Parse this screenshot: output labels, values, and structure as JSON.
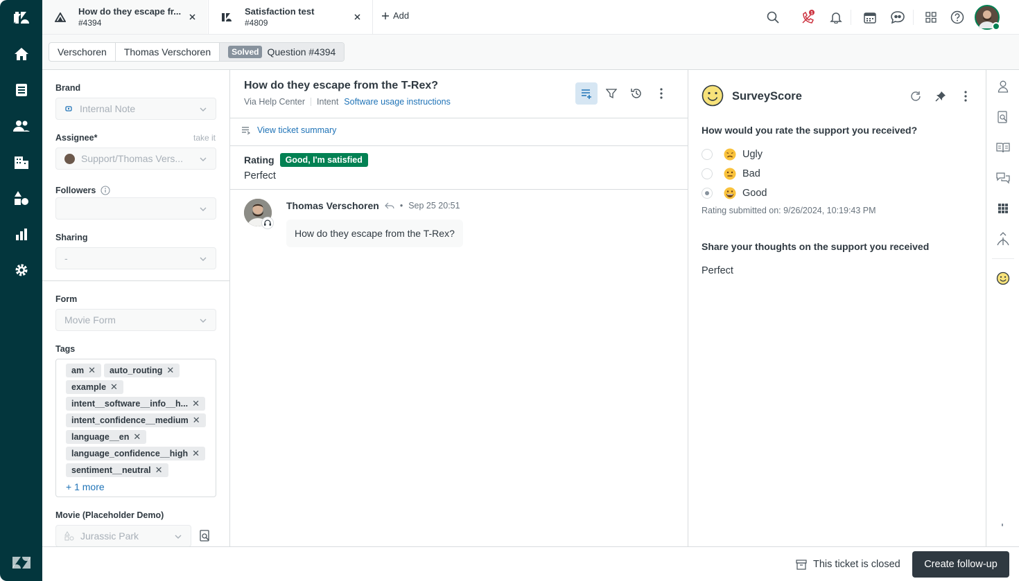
{
  "tabs": [
    {
      "title": "How do they escape fr...",
      "id": "#4394",
      "icon": "ticket-question-icon"
    },
    {
      "title": "Satisfaction test",
      "id": "#4809",
      "icon": "zendesk-ticket-icon"
    }
  ],
  "add_tab_label": "Add",
  "top_icons": [
    "search-icon",
    "phone-icon",
    "bell-icon",
    "calendar-icon",
    "chat-icon",
    "apps-grid-icon",
    "help-icon",
    "avatar"
  ],
  "phone_badge": "1",
  "breadcrumb": {
    "org": "Verschoren",
    "requester": "Thomas Verschoren",
    "status": "Solved",
    "ticket": "Question #4394"
  },
  "props": {
    "brand_label": "Brand",
    "brand_value": "Internal Note",
    "assignee_label": "Assignee*",
    "take_it": "take it",
    "assignee_value": "Support/Thomas Vers...",
    "followers_label": "Followers",
    "sharing_label": "Sharing",
    "sharing_value": "-",
    "form_label": "Form",
    "form_value": "Movie Form",
    "tags_label": "Tags",
    "tags": [
      "am",
      "auto_routing",
      "example",
      "intent__software__info__h...",
      "intent_confidence__medium",
      "language__en",
      "language_confidence__high",
      "sentiment__neutral"
    ],
    "more_tags": "+ 1 more",
    "movie_label": "Movie (Placeholder Demo)",
    "movie_value": "Jurassic Park"
  },
  "conversation": {
    "title": "How do they escape from the T-Rex?",
    "via": "Via Help Center",
    "intent_label": "Intent",
    "intent_value": "Software usage instructions",
    "summary_link": "View ticket summary",
    "rating_label": "Rating",
    "rating_badge": "Good, I'm satisfied",
    "rating_comment": "Perfect",
    "message": {
      "author": "Thomas Verschoren",
      "time": "Sep 25 20:51",
      "body": "How do they escape from the T-Rex?"
    }
  },
  "app": {
    "title": "SurveyScore",
    "question1": "How would you rate the support you received?",
    "options": [
      {
        "label": "Ugly",
        "selected": false,
        "icon": "disappointed-face-icon"
      },
      {
        "label": "Bad",
        "selected": false,
        "icon": "neutral-face-icon"
      },
      {
        "label": "Good",
        "selected": true,
        "icon": "grinning-face-icon"
      }
    ],
    "submitted": "Rating submitted on: 9/26/2024, 10:19:43 PM",
    "question2": "Share your thoughts on the support you received",
    "answer2": "Perfect"
  },
  "footer": {
    "closed_note": "This ticket is closed",
    "followup_button": "Create follow-up"
  },
  "colors": {
    "nav_bg": "#03363d",
    "accent_blue": "#1f73b7",
    "success_green": "#038153",
    "dark_button": "#2f3941",
    "status_grey": "#87929d"
  }
}
